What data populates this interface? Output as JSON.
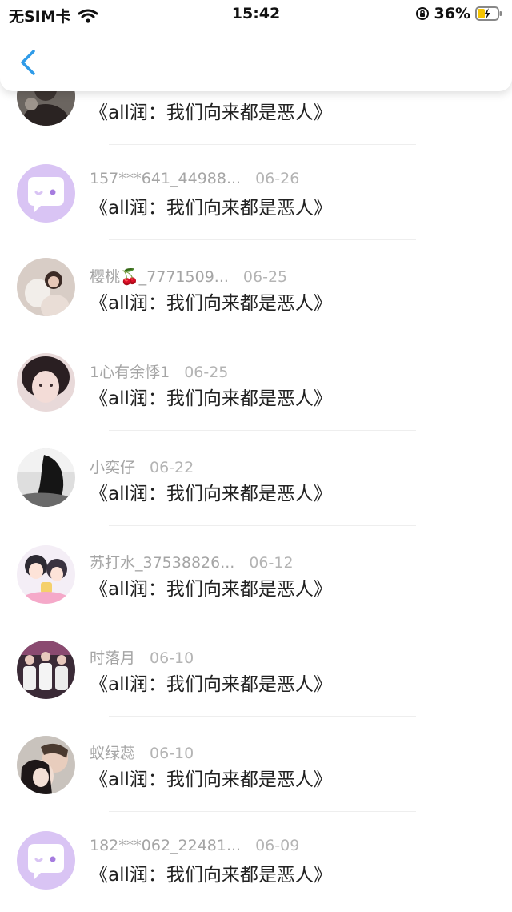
{
  "status_bar": {
    "carrier": "无SIM卡",
    "time": "15:42",
    "battery_percent": "36%",
    "battery_level": 0.36
  },
  "nav": {
    "back_icon": "chevron-left-icon",
    "accent_color": "#2f9be8"
  },
  "colors": {
    "placeholder_avatar": "#d9c4f4"
  },
  "items": [
    {
      "username": "",
      "date": "",
      "title": "《all润：我们向来都是恶人》",
      "avatar": "photo"
    },
    {
      "username": "157***641_44988...",
      "date": "06-26",
      "title": "《all润：我们向来都是恶人》",
      "avatar": "default-chat-icon"
    },
    {
      "username": "樱桃🍒_7771509...",
      "date": "06-25",
      "title": "《all润：我们向来都是恶人》",
      "avatar": "photo"
    },
    {
      "username": "1心有余悸1",
      "date": "06-25",
      "title": "《all润：我们向来都是恶人》",
      "avatar": "photo"
    },
    {
      "username": "小奕仔",
      "date": "06-22",
      "title": "《all润：我们向来都是恶人》",
      "avatar": "photo"
    },
    {
      "username": "苏打水_37538826...",
      "date": "06-12",
      "title": "《all润：我们向来都是恶人》",
      "avatar": "photo"
    },
    {
      "username": "时落月",
      "date": "06-10",
      "title": "《all润：我们向来都是恶人》",
      "avatar": "photo"
    },
    {
      "username": "蚁绿蕊",
      "date": "06-10",
      "title": "《all润：我们向来都是恶人》",
      "avatar": "photo"
    },
    {
      "username": "182***062_22481...",
      "date": "06-09",
      "title": "《all润：我们向来都是恶人》",
      "avatar": "default-chat-icon"
    }
  ]
}
